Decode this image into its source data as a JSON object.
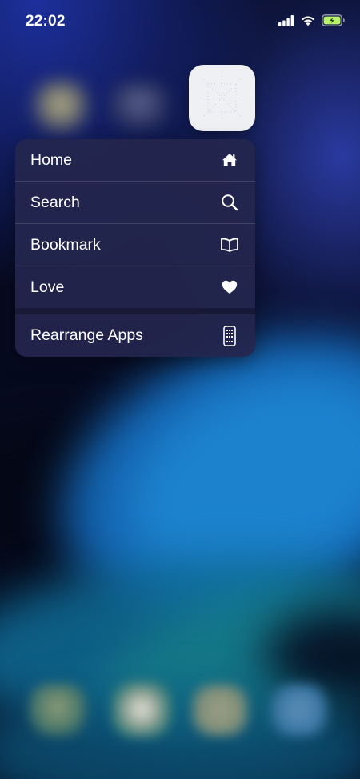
{
  "status_bar": {
    "time": "22:02",
    "signal_icon": "cellular-signal-icon",
    "wifi_icon": "wifi-icon",
    "battery_icon": "battery-charging-icon",
    "battery_color": "#b6f36b"
  },
  "focused_app": {
    "icon": "app-icon",
    "background": "#eef0f4"
  },
  "context_menu": {
    "items": [
      {
        "label": "Home",
        "icon": "house-icon"
      },
      {
        "label": "Search",
        "icon": "magnifier-icon"
      },
      {
        "label": "Bookmark",
        "icon": "open-book-icon"
      },
      {
        "label": "Love",
        "icon": "heart-icon"
      }
    ],
    "system_action": {
      "label": "Rearrange Apps",
      "icon": "phone-grid-icon"
    }
  },
  "colors": {
    "menu_background": "#24264e",
    "text": "#ffffff"
  }
}
